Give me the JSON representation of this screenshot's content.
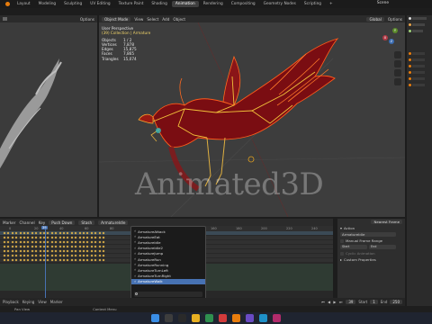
{
  "topbar": {
    "tabs": [
      "Layout",
      "Modeling",
      "Sculpting",
      "UV Editing",
      "Texture Paint",
      "Shading",
      "Animation",
      "Rendering",
      "Compositing",
      "Geometry Nodes",
      "Scripting",
      "+"
    ],
    "active_tab": "Animation",
    "scene": "Scene"
  },
  "left_view": {
    "options": "Options"
  },
  "main_view": {
    "mode": "Object Mode",
    "menus": [
      "View",
      "Select",
      "Add",
      "Object"
    ],
    "orientation": "Global",
    "options": "Options",
    "perspective": "User Perspective",
    "collection": "(39) Collection | Armature",
    "stats": [
      {
        "label": "Objects",
        "value": "1 / 2"
      },
      {
        "label": "Vertices",
        "value": "7,878"
      },
      {
        "label": "Edges",
        "value": "15,875"
      },
      {
        "label": "Faces",
        "value": "7,865"
      },
      {
        "label": "Triangles",
        "value": "15,074"
      }
    ],
    "axes": [
      "Y",
      "X",
      "Z"
    ]
  },
  "watermark": "Animated3D",
  "timeline": {
    "menus": [
      "Marker",
      "Channel",
      "Key"
    ],
    "push_down": "Push Down",
    "stash": "Stash",
    "action": "ArmatureIdle",
    "frames": [
      "0",
      "20",
      "40",
      "60",
      "80",
      "100",
      "120",
      "140",
      "160",
      "180",
      "200",
      "220",
      "240"
    ],
    "current_frame": "39"
  },
  "actions_dropdown": {
    "items": [
      "ArmatureAttack",
      "ArmatureEat",
      "ArmatureIdle",
      "ArmatureIdle2",
      "ArmatureJump",
      "ArmatureRun",
      "ArmatureRunning",
      "ArmatureTurnLeft",
      "ArmatureTurnRight",
      "ArmatureWalk"
    ],
    "active": "ArmatureWalk"
  },
  "sidepanel": {
    "header": "Nearest Frame",
    "section": "Action",
    "action": "ArmatureIdle",
    "manual_range": "Manual Frame Range",
    "start": "Start",
    "end": "End",
    "cyclic": "Cyclic Animation",
    "custom_props": "Custom Properties"
  },
  "playback": {
    "labels": [
      "Playback",
      "Keying",
      "View",
      "Marker"
    ],
    "frame": "39",
    "start_label": "Start",
    "start": "1",
    "end_label": "End",
    "end": "250"
  },
  "statusbar": {
    "items": [
      "Pan View",
      "Context Menu"
    ]
  },
  "colors": {
    "accent": "#4772b3",
    "active_tab": "#3f3f3f",
    "bird_glow": "#ff5a1a",
    "bird_body": "#7a0d12"
  }
}
